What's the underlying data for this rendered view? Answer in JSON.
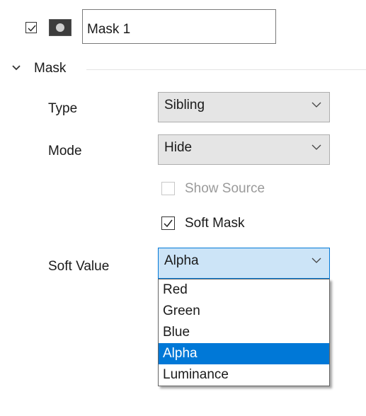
{
  "layer": {
    "enabled": true,
    "thumbnail_icon": "layer-thumbnail-icon",
    "name_value": "Mask 1"
  },
  "section": {
    "title": "Mask",
    "expanded": true,
    "icon": "chevron-down-icon"
  },
  "fields": {
    "type": {
      "label": "Type",
      "value": "Sibling"
    },
    "mode": {
      "label": "Mode",
      "value": "Hide"
    },
    "show_source": {
      "label": "Show Source",
      "checked": false,
      "disabled": true
    },
    "soft_mask": {
      "label": "Soft Mask",
      "checked": true
    },
    "soft_value": {
      "label": "Soft Value",
      "value": "Alpha",
      "options": [
        "Red",
        "Green",
        "Blue",
        "Alpha",
        "Luminance"
      ],
      "highlighted": "Alpha"
    }
  },
  "colors": {
    "accent": "#0078d7",
    "focus_bg": "#cce4f7",
    "combo_bg": "#e5e5e5"
  }
}
